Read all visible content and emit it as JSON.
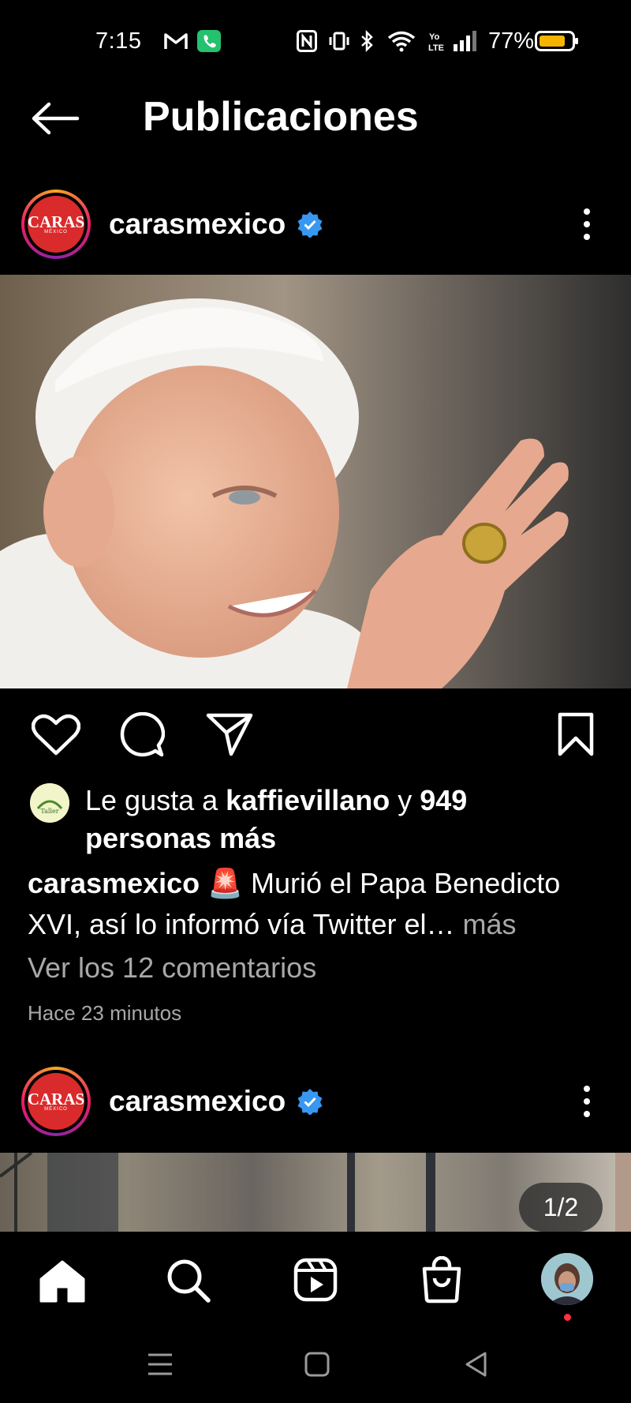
{
  "status_bar": {
    "time": "7:15",
    "battery": "77%"
  },
  "header": {
    "title": "Publicaciones"
  },
  "post1": {
    "logo_text": "CARAS",
    "logo_sub": "MÉXICO",
    "username": "carasmexico",
    "liked_by_prefix": "Le gusta a ",
    "liked_by_user": "kaffievillano",
    "liked_by_mid": " y ",
    "liked_by_count": "949 personas más",
    "caption_user": "carasmexico",
    "caption_emoji": "🚨",
    "caption_text": " Murió el Papa Benedicto XVI, así lo informó vía Twitter el… ",
    "caption_more": "más",
    "comments_link": "Ver los 12 comentarios",
    "time_ago": "Hace 23 minutos"
  },
  "post2": {
    "logo_text": "CARAS",
    "logo_sub": "MÉXICO",
    "username": "carasmexico",
    "carousel_counter": "1/2"
  },
  "colors": {
    "verified": "#3897f0",
    "notification_dot": "#ff3040",
    "muted_text": "#a8a8a8"
  },
  "icons": {
    "nav": [
      "home-icon",
      "search-icon",
      "reels-icon",
      "shop-icon",
      "profile-avatar"
    ],
    "actions": [
      "heart-icon",
      "comment-icon",
      "share-icon",
      "save-icon"
    ]
  }
}
